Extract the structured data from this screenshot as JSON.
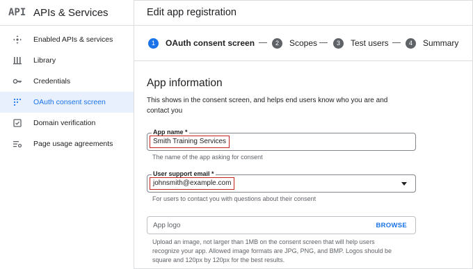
{
  "sidebar": {
    "logo": "API",
    "title": "APIs & Services",
    "items": [
      {
        "label": "Enabled APIs & services",
        "icon": "apis-icon"
      },
      {
        "label": "Library",
        "icon": "library-icon"
      },
      {
        "label": "Credentials",
        "icon": "key-icon"
      },
      {
        "label": "OAuth consent screen",
        "icon": "consent-icon",
        "active": true
      },
      {
        "label": "Domain verification",
        "icon": "checkbox-icon"
      },
      {
        "label": "Page usage agreements",
        "icon": "settings-list-icon"
      }
    ]
  },
  "header": {
    "title": "Edit app registration"
  },
  "stepper": {
    "steps": [
      {
        "num": "1",
        "label": "OAuth consent screen",
        "active": true
      },
      {
        "num": "2",
        "label": "Scopes"
      },
      {
        "num": "3",
        "label": "Test users"
      },
      {
        "num": "4",
        "label": "Summary"
      }
    ]
  },
  "main": {
    "section_title": "App information",
    "section_desc": "This shows in the consent screen, and helps end users know who you are and contact you",
    "app_name": {
      "label": "App name *",
      "value": "Smith Training Services",
      "hint": "The name of the app asking for consent"
    },
    "support_email": {
      "label": "User support email *",
      "value": "johnsmith@example.com",
      "hint": "For users to contact you with questions about their consent"
    },
    "app_logo": {
      "placeholder": "App logo",
      "browse_label": "BROWSE",
      "hint": "Upload an image, not larger than 1MB on the consent screen that will help users recognize your app. Allowed image formats are JPG, PNG, and BMP. Logos should be square and 120px by 120px for the best results."
    }
  },
  "colors": {
    "accent": "#1a73e8",
    "active_bg": "#e8f0fe",
    "highlight_border": "#c5221f"
  }
}
